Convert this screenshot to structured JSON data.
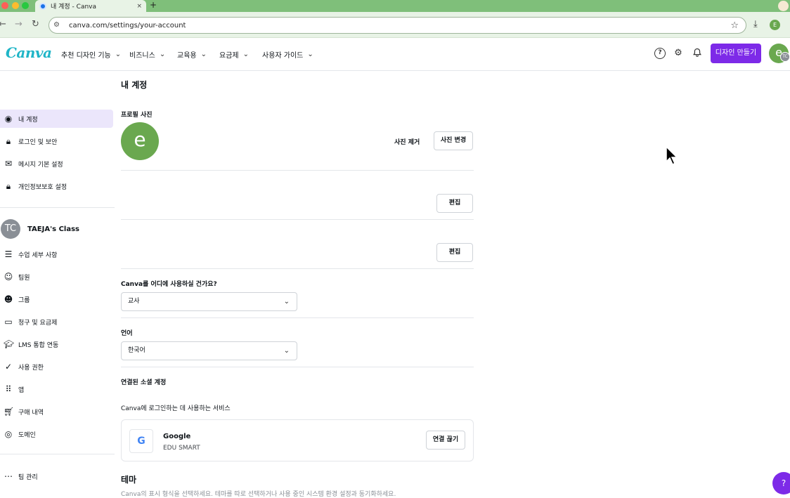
{
  "browser": {
    "tab_title": "내 계정 - Canva",
    "tab_close": "×",
    "new_tab": "+",
    "url": "canva.com/settings/your-account",
    "profile_initial": "E"
  },
  "header": {
    "logo": "Canva",
    "menu": [
      "추천 디자인 기능",
      "비즈니스",
      "교육용",
      "요금제",
      "사용자 가이드"
    ],
    "create_button": "디자인 만들기",
    "avatar_initial": "e",
    "avatar_sub_initials": "TC"
  },
  "sidebar": {
    "account_items": [
      {
        "label": "내 계정",
        "icon": "user-circle-icon"
      },
      {
        "label": "로그인 및 보안",
        "icon": "lock-icon"
      },
      {
        "label": "메시지 기본 설정",
        "icon": "mail-icon"
      },
      {
        "label": "개인정보보호 설정",
        "icon": "privacy-lock-icon"
      }
    ],
    "team": {
      "initials": "TC",
      "name": "TAEJA's Class"
    },
    "team_items": [
      {
        "label": "수업 세부 사항",
        "icon": "list-icon"
      },
      {
        "label": "팀원",
        "icon": "people-icon"
      },
      {
        "label": "그룹",
        "icon": "group-icon"
      },
      {
        "label": "청구 및 요금제",
        "icon": "card-icon"
      },
      {
        "label": "LMS 통합 연동",
        "icon": "graduation-cap-icon"
      },
      {
        "label": "사용 권한",
        "icon": "check-circle-icon"
      },
      {
        "label": "앱",
        "icon": "grid-icon"
      },
      {
        "label": "구매 내역",
        "icon": "cart-icon"
      },
      {
        "label": "도메인",
        "icon": "globe-icon"
      }
    ],
    "manage_team": "팀 관리"
  },
  "main": {
    "title": "내 계정",
    "profile_photo_label": "프로필 사진",
    "avatar_initial": "e",
    "remove_photo": "사진 제거",
    "change_photo": "사진 변경",
    "edit_1": "편집",
    "edit_2": "편집",
    "usage_question": "Canva를 어디에 사용하실 건가요?",
    "usage_value": "교사",
    "language_label": "언어",
    "language_value": "한국어",
    "social_label": "연결된 소셜 계정",
    "social_desc": "Canva에 로그인하는 데 사용하는 서비스",
    "service": {
      "name": "Google",
      "account": "EDU SMART",
      "disconnect": "연결 끊기",
      "logo": "G"
    },
    "theme_title": "테마",
    "theme_desc": "Canva의 표시 형식을 선택하세요. 테마를 따로 선택하거나 사용 중인 시스템 환경 설정과 동기화하세요."
  },
  "help_fab": "?",
  "colors": {
    "accent": "#7d2ae8",
    "active_bg": "#ebe6fb",
    "avatar": "#6aa84f",
    "logo": "#1fb5c7"
  }
}
